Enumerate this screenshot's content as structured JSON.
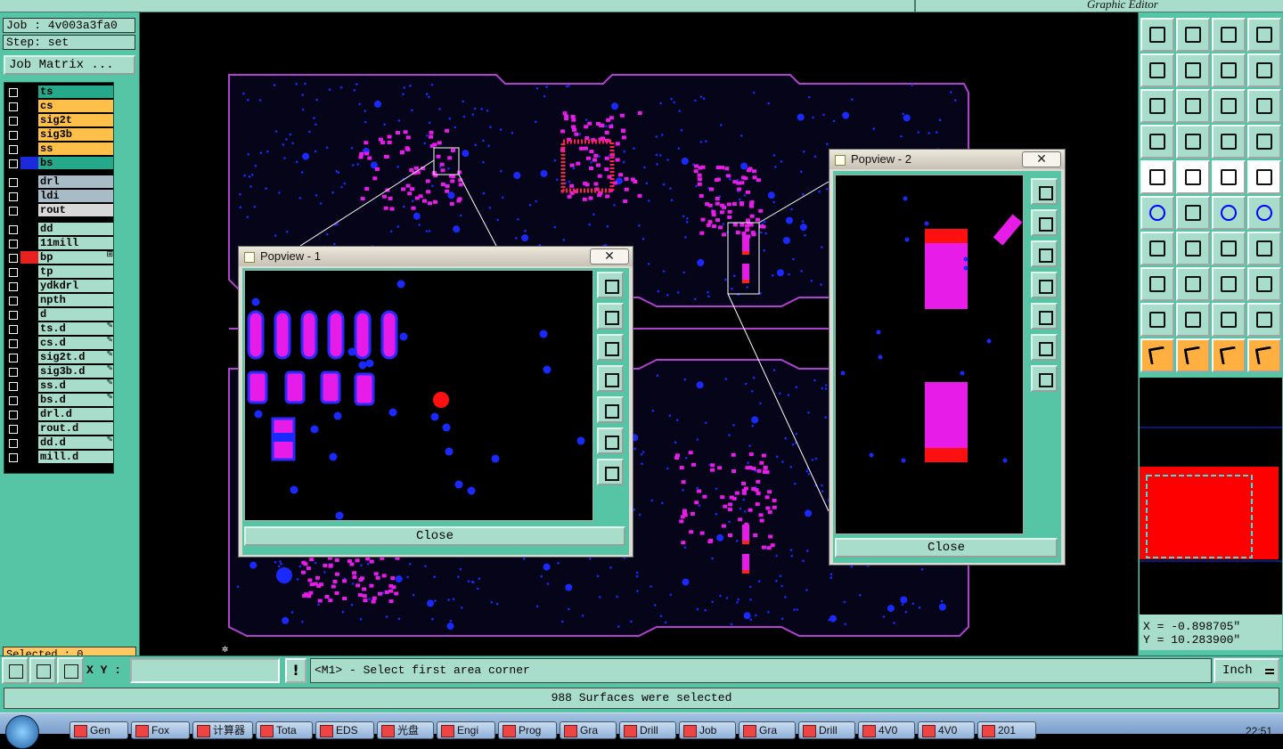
{
  "topbar": {
    "title": "Graphic Editor"
  },
  "job": {
    "job_label": "Job : 4v003a3fa0",
    "step_label": "Step: set",
    "matrix_button": "Job Matrix ..."
  },
  "layers": [
    {
      "name": "ts",
      "color": "#26a88a",
      "swatch": "#000",
      "ed": ""
    },
    {
      "name": "cs",
      "color": "#ffc04a",
      "swatch": "#000",
      "ed": ""
    },
    {
      "name": "sig2t",
      "color": "#ffc04a",
      "swatch": "#000",
      "ed": ""
    },
    {
      "name": "sig3b",
      "color": "#ffc04a",
      "swatch": "#000",
      "ed": ""
    },
    {
      "name": "ss",
      "color": "#ffc04a",
      "swatch": "#000",
      "ed": ""
    },
    {
      "name": "bs",
      "color": "#26a88a",
      "swatch": "#1a2adc",
      "ed": ""
    },
    {
      "name": "drl",
      "color": "#a8bcc8",
      "swatch": "#000",
      "ed": "",
      "gap": true
    },
    {
      "name": "ldi",
      "color": "#a8bcc8",
      "swatch": "#000",
      "ed": ""
    },
    {
      "name": "rout",
      "color": "#d8d8d8",
      "swatch": "#000",
      "ed": ""
    },
    {
      "name": "dd",
      "color": "#a8dccb",
      "swatch": "#000",
      "ed": "",
      "gap": true
    },
    {
      "name": "11mill",
      "color": "#a8dccb",
      "swatch": "#000",
      "ed": ""
    },
    {
      "name": "bp",
      "color": "#a8dccb",
      "swatch": "#e82020",
      "ed": "⊞"
    },
    {
      "name": "tp",
      "color": "#a8dccb",
      "swatch": "#000",
      "ed": ""
    },
    {
      "name": "ydkdrl",
      "color": "#a8dccb",
      "swatch": "#000",
      "ed": ""
    },
    {
      "name": "npth",
      "color": "#a8dccb",
      "swatch": "#000",
      "ed": ""
    },
    {
      "name": "d",
      "color": "#a8dccb",
      "swatch": "#000",
      "ed": ""
    },
    {
      "name": "ts.d",
      "color": "#a8dccb",
      "swatch": "#000",
      "ed": "✎"
    },
    {
      "name": "cs.d",
      "color": "#a8dccb",
      "swatch": "#000",
      "ed": "✎"
    },
    {
      "name": "sig2t.d",
      "color": "#a8dccb",
      "swatch": "#000",
      "ed": "✎"
    },
    {
      "name": "sig3b.d",
      "color": "#a8dccb",
      "swatch": "#000",
      "ed": "✎"
    },
    {
      "name": "ss.d",
      "color": "#a8dccb",
      "swatch": "#000",
      "ed": "✎"
    },
    {
      "name": "bs.d",
      "color": "#a8dccb",
      "swatch": "#000",
      "ed": "✎"
    },
    {
      "name": "drl.d",
      "color": "#a8dccb",
      "swatch": "#000",
      "ed": ""
    },
    {
      "name": "rout.d",
      "color": "#a8dccb",
      "swatch": "#000",
      "ed": ""
    },
    {
      "name": "dd.d",
      "color": "#a8dccb",
      "swatch": "#000",
      "ed": "✎"
    },
    {
      "name": "mill.d",
      "color": "#a8dccb",
      "swatch": "#000",
      "ed": ""
    }
  ],
  "selected": "Selected : 0",
  "popview1": {
    "title": "Popview - 1",
    "close": "Close",
    "close_x": "✕"
  },
  "popview2": {
    "title": "Popview - 2",
    "close": "Close",
    "close_x": "✕"
  },
  "coords": {
    "x": "X = -0.898705\"",
    "y": "Y = 10.283900\""
  },
  "bottom": {
    "xy_label": "X Y :",
    "xy_value": "",
    "warn": "!",
    "prompt": "<M1> - Select first area corner",
    "units": "Inch"
  },
  "status": "988 Surfaces were selected",
  "taskbar": {
    "items": [
      "Gen",
      "Fox",
      "计算器",
      "Tota",
      "EDS",
      "光盘",
      "Engi",
      "Prog",
      "Gra",
      "Drill",
      "Job",
      "Gra",
      "Drill",
      "4V0",
      "4V0",
      "201"
    ],
    "clock": "22:51"
  },
  "colors": {
    "panel": "#55c5a5",
    "light": "#a8dccb",
    "pad": "#e81ce8",
    "via": "#1a2aff",
    "outline": "#b040d0",
    "selection": "#ff0000"
  }
}
